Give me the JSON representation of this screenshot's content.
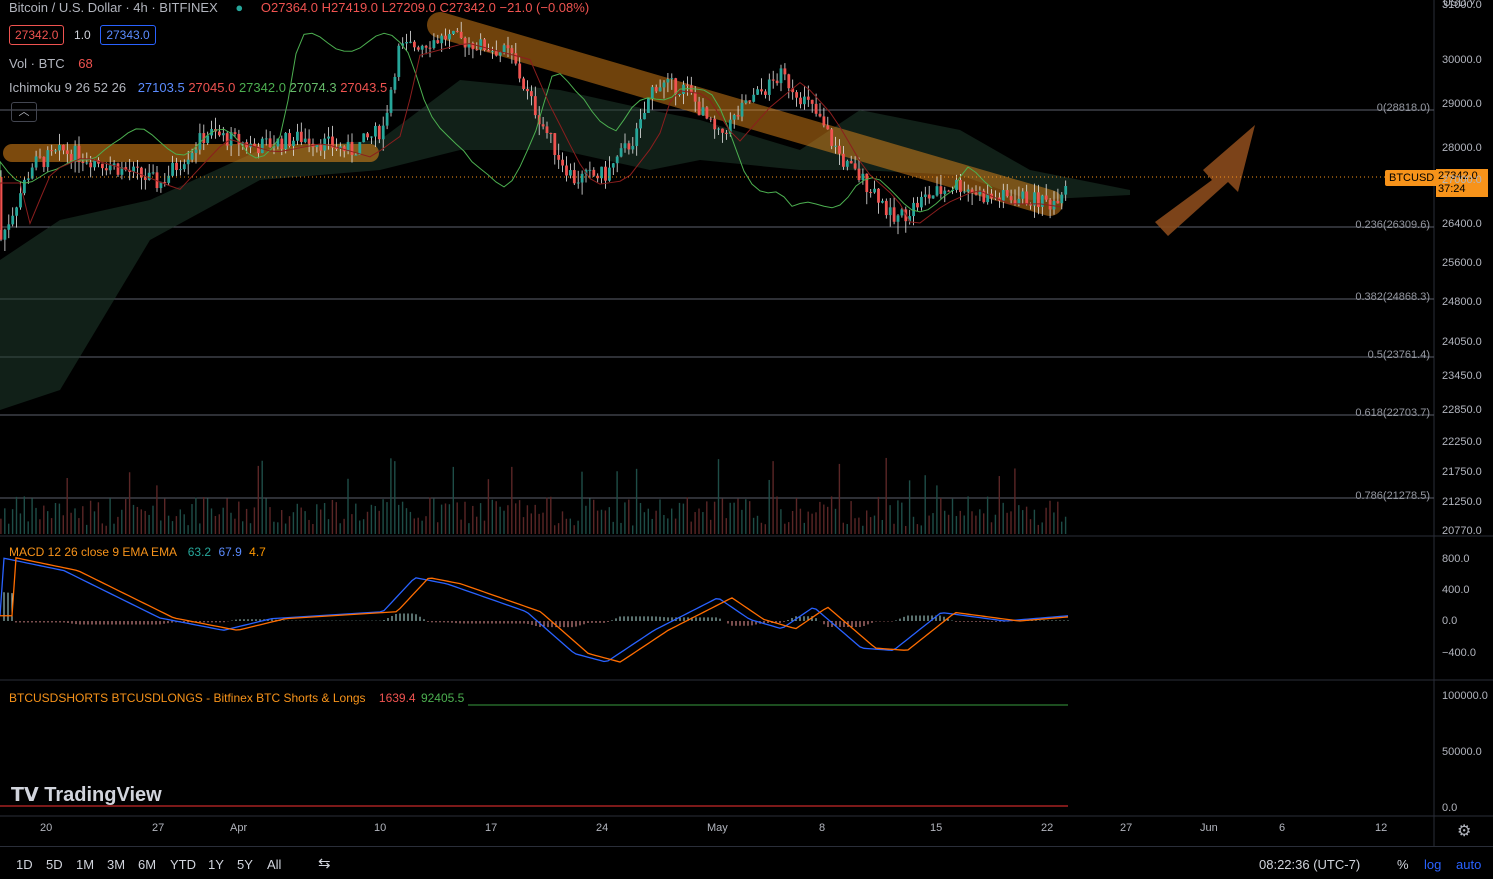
{
  "header": {
    "symbol": "Bitcoin / U.S. Dollar · 4h · BITFINEX",
    "o_label": "O",
    "o": "27364.0",
    "h_label": "H",
    "h": "27419.0",
    "l_label": "L",
    "l": "27209.0",
    "c_label": "C",
    "c": "27342.0",
    "change": "−21.0 (−0.08%)",
    "sell": "27342.0",
    "spread": "1.0",
    "buy": "27343.0",
    "vol_label": "Vol · BTC",
    "vol_value": "68",
    "ichimoku_label": "Ichimoku 9 26 52 26",
    "ichimoku_values": [
      "27103.5",
      "27045.0",
      "27342.0",
      "27074.3",
      "27043.5"
    ],
    "currency": "USD"
  },
  "colors": {
    "up": "#26a69a",
    "down": "#ef5350",
    "accent": "#f7931a",
    "macd": "#2962ff",
    "signal": "#ff6d00",
    "text": "#d1d4dc"
  },
  "price_axis": {
    "ticks": [
      "31000.0",
      "30000.0",
      "29000.0",
      "28000.0",
      "27000.0",
      "26400.0",
      "25600.0",
      "24800.0",
      "24050.0",
      "23450.0",
      "22850.0",
      "22250.0",
      "21750.0",
      "21250.0",
      "20770.0"
    ],
    "current_symbol": "BTCUSD",
    "current_price": "27342.0",
    "countdown": "37:24"
  },
  "fib_levels": [
    {
      "label": "0(28818.0)"
    },
    {
      "label": "0.236(26309.6)"
    },
    {
      "label": "0.382(24868.3)"
    },
    {
      "label": "0.5(23761.4)"
    },
    {
      "label": "0.618(22703.7)"
    },
    {
      "label": "0.786(21278.5)"
    }
  ],
  "macd": {
    "label": "MACD 12 26 close 9 EMA EMA",
    "values": [
      "63.2",
      "67.9",
      "4.7"
    ],
    "axis": [
      "800.0",
      "400.0",
      "0.0",
      "−400.0"
    ]
  },
  "shorts_longs": {
    "label": "BTCUSDSHORTS BTCUSDLONGS - Bitfinex BTC Shorts & Longs",
    "shorts": "1639.4",
    "longs": "92405.5",
    "axis": [
      "100000.0",
      "50000.0",
      "0.0"
    ]
  },
  "time_axis": [
    "20",
    "27",
    "Apr",
    "10",
    "17",
    "24",
    "May",
    "8",
    "15",
    "22",
    "27",
    "Jun",
    "6",
    "12"
  ],
  "bottom_bar": {
    "ranges": [
      "1D",
      "5D",
      "1M",
      "3M",
      "6M",
      "YTD",
      "1Y",
      "5Y",
      "All"
    ],
    "clock": "08:22:36 (UTC-7)",
    "percent": "%",
    "log": "log",
    "auto": "auto"
  },
  "logo": "TradingView",
  "chart_data": {
    "type": "candlestick",
    "symbol": "BTCUSD",
    "timeframe": "4h",
    "price_close_path": [
      [
        "Mar 17",
        26000
      ],
      [
        "Mar 19",
        27600
      ],
      [
        "Mar 21",
        27900
      ],
      [
        "Mar 24",
        27600
      ],
      [
        "Mar 27",
        27200
      ],
      [
        "Mar 30",
        28300
      ],
      [
        "Apr 2",
        28000
      ],
      [
        "Apr 5",
        28200
      ],
      [
        "Apr 8",
        27900
      ],
      [
        "Apr 10",
        28400
      ],
      [
        "Apr 11",
        30200
      ],
      [
        "Apr 14",
        30500
      ],
      [
        "Apr 16",
        30300
      ],
      [
        "Apr 18",
        30100
      ],
      [
        "Apr 19",
        29200
      ],
      [
        "Apr 21",
        27800
      ],
      [
        "Apr 22",
        27300
      ],
      [
        "Apr 24",
        27400
      ],
      [
        "Apr 26",
        28300
      ],
      [
        "Apr 27",
        29400
      ],
      [
        "Apr 29",
        29300
      ],
      [
        "May 1",
        28200
      ],
      [
        "May 3",
        29000
      ],
      [
        "May 5",
        29600
      ],
      [
        "May 7",
        28800
      ],
      [
        "May 9",
        27600
      ],
      [
        "May 11",
        27000
      ],
      [
        "May 12",
        26400
      ],
      [
        "May 14",
        26900
      ],
      [
        "May 16",
        27200
      ],
      [
        "May 18",
        26900
      ],
      [
        "May 20",
        26900
      ],
      [
        "May 22",
        26800
      ],
      [
        "May 23",
        27342
      ]
    ],
    "macd_path": [
      [
        "Mar 17",
        820
      ],
      [
        "Mar 21",
        650
      ],
      [
        "Mar 27",
        40
      ],
      [
        "Mar 31",
        -120
      ],
      [
        "Apr 3",
        30
      ],
      [
        "Apr 10",
        120
      ],
      [
        "Apr 12",
        560
      ],
      [
        "Apr 14",
        480
      ],
      [
        "Apr 19",
        120
      ],
      [
        "Apr 22",
        -420
      ],
      [
        "Apr 24",
        -530
      ],
      [
        "Apr 27",
        -120
      ],
      [
        "May 1",
        300
      ],
      [
        "May 3",
        20
      ],
      [
        "May 5",
        -100
      ],
      [
        "May 7",
        180
      ],
      [
        "May 10",
        -350
      ],
      [
        "May 12",
        -380
      ],
      [
        "May 15",
        110
      ],
      [
        "May 19",
        0
      ],
      [
        "May 23",
        68
      ]
    ]
  }
}
